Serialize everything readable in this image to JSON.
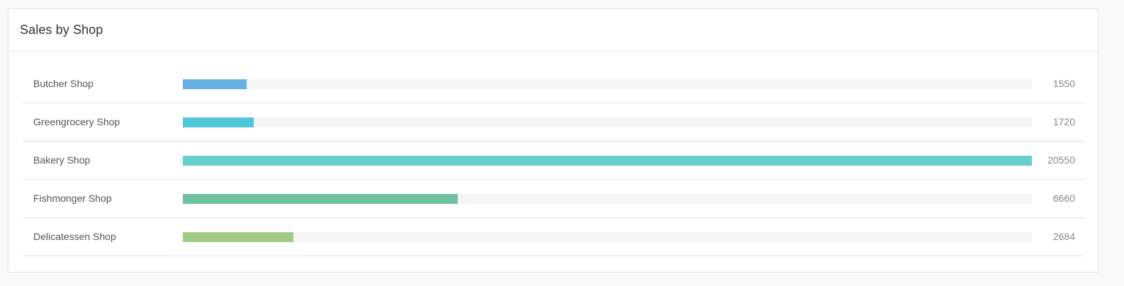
{
  "panel": {
    "title": "Sales by Shop"
  },
  "chart_data": {
    "type": "bar",
    "orientation": "horizontal",
    "title": "Sales by Shop",
    "categories": [
      "Butcher Shop",
      "Greengrocery Shop",
      "Bakery Shop",
      "Fishmonger Shop",
      "Delicatessen Shop"
    ],
    "values": [
      1550,
      1720,
      20550,
      6660,
      2684
    ],
    "value_labels": [
      "1550",
      "1720",
      "20550",
      "6660",
      "2684"
    ],
    "colors": [
      "#65b2e2",
      "#4fc5d9",
      "#65cfc9",
      "#6dc3a0",
      "#a0cb84"
    ],
    "track_color": "#f5f5f5",
    "xlim": [
      0,
      20550
    ],
    "grid": false,
    "legend": "none"
  }
}
